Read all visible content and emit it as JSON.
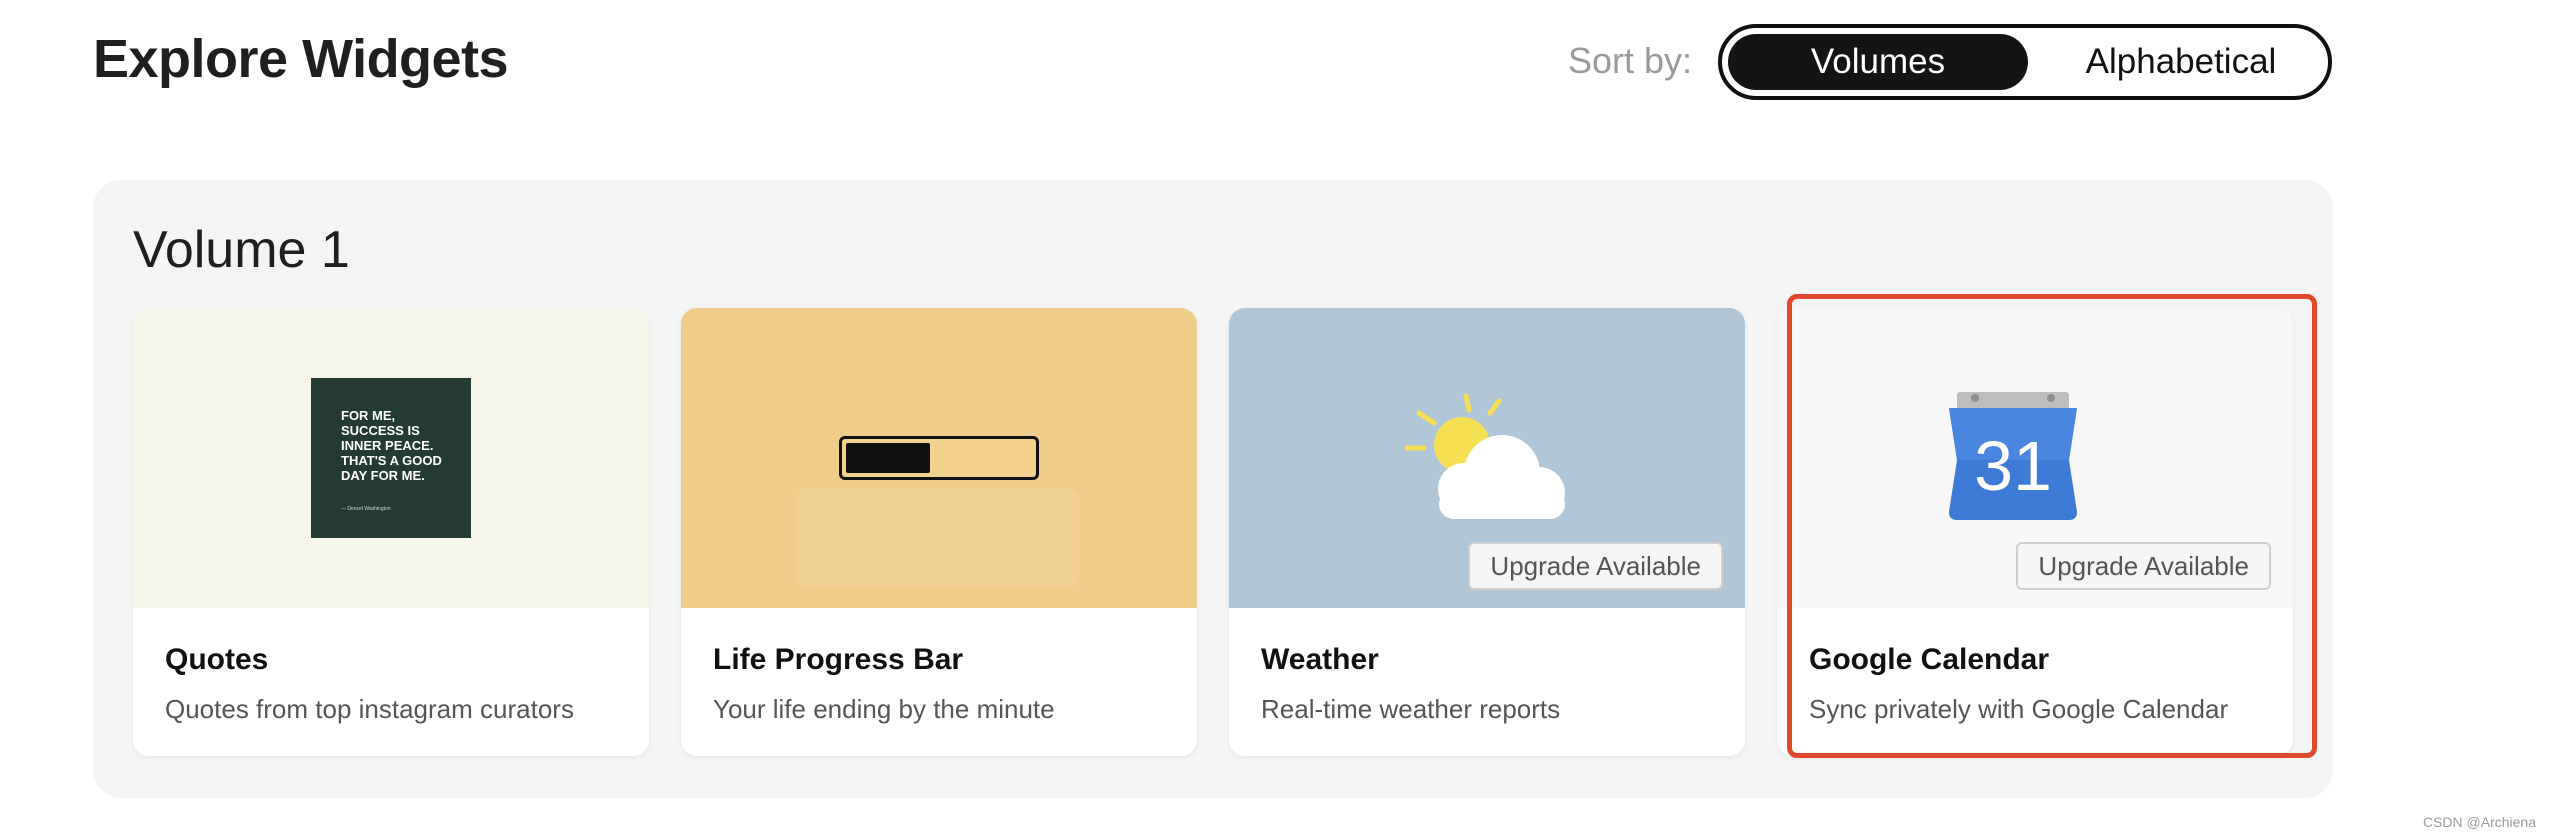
{
  "header": {
    "title": "Explore Widgets",
    "sort_label": "Sort by:",
    "sort_options": [
      "Volumes",
      "Alphabetical"
    ],
    "sort_selected": "Volumes"
  },
  "volume": {
    "title": "Volume 1",
    "cards": [
      {
        "name": "Quotes",
        "description": "Quotes from top instagram curators",
        "media_bg": "#f6f5ea",
        "quote_text": "FOR ME, SUCCESS IS INNER PEACE. THAT'S A GOOD DAY FOR ME.",
        "quote_credit": "— Denzel Washington"
      },
      {
        "name": "Life Progress Bar",
        "description": "Your life ending by the minute",
        "media_bg": "#f0cc8b",
        "progress_fraction": 0.45
      },
      {
        "name": "Weather",
        "description": "Real-time weather reports",
        "media_bg": "#b0c6d6",
        "badge": "Upgrade Available",
        "icon": "sun-cloud-icon"
      },
      {
        "name": "Google Calendar",
        "description": "Sync privately with Google Calendar",
        "media_bg": "#f7f7f7",
        "badge": "Upgrade Available",
        "icon": "google-calendar-icon",
        "calendar_day": "31",
        "highlighted": true
      }
    ]
  },
  "colors": {
    "accent_dark": "#141414",
    "highlight": "#e04a2c",
    "calendar_blue": "#3d7ad6"
  },
  "watermark": "CSDN @Archiena"
}
